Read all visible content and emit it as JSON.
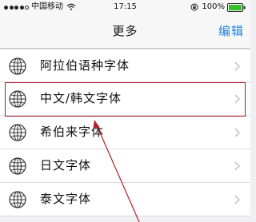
{
  "status_bar": {
    "carrier": "中国移动",
    "time": "17:15",
    "battery": "100%",
    "signal_bars_filled": 4,
    "signal_bars_total": 5
  },
  "nav": {
    "title": "更多",
    "edit_label": "编辑"
  },
  "fonts": {
    "items": [
      {
        "label": "阿拉伯语种字体",
        "icon": "globe-icon"
      },
      {
        "label": "中文/韩文字体",
        "icon": "globe-icon"
      },
      {
        "label": "希伯来字体",
        "icon": "globe-icon"
      },
      {
        "label": "日文字体",
        "icon": "globe-icon"
      },
      {
        "label": "泰文字体",
        "icon": "globe-icon"
      }
    ],
    "highlighted_index": 1
  },
  "colors": {
    "accent": "#1a82e2",
    "highlight": "#b0202a",
    "background": "#efeff4"
  }
}
